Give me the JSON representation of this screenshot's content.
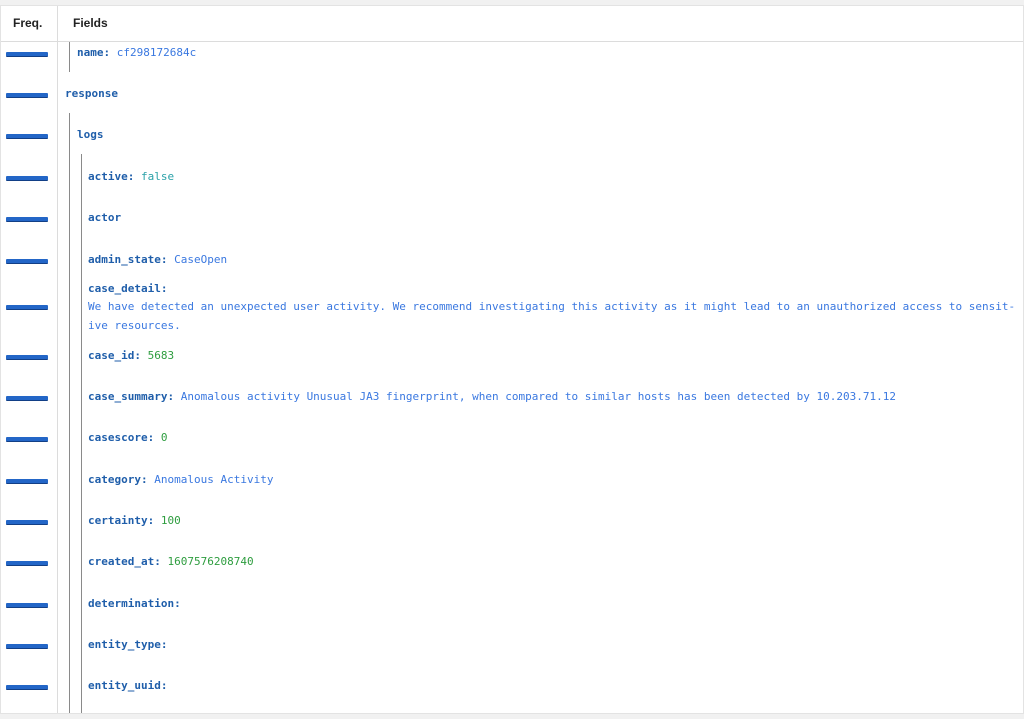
{
  "header": {
    "freq_label": "Freq.",
    "fields_label": "Fields"
  },
  "rows": {
    "name": {
      "key": "name",
      "value": "cf298172684c"
    },
    "response": {
      "key": "response"
    },
    "logs": {
      "key": "logs"
    },
    "active": {
      "key": "active",
      "value": "false"
    },
    "actor": {
      "key": "actor"
    },
    "admin_state": {
      "key": "admin_state",
      "value": "CaseOpen"
    },
    "case_detail": {
      "key": "case_detail",
      "value_line1": "We have detected an unexpected user activity. We recommend investigating this activity as it might lead to an unauthorized access to sensit-",
      "value_line2": "ive resources."
    },
    "case_id": {
      "key": "case_id",
      "value": "5683"
    },
    "case_summary": {
      "key": "case_summary",
      "value": "Anomalous activity Unusual JA3 fingerprint, when compared to similar hosts has been detected by 10.203.71.12"
    },
    "casescore": {
      "key": "casescore",
      "value": "0"
    },
    "category": {
      "key": "category",
      "value": "Anomalous Activity"
    },
    "certainty": {
      "key": "certainty",
      "value": "100"
    },
    "created_at": {
      "key": "created_at",
      "value": "1607576208740"
    },
    "determination": {
      "key": "determination"
    },
    "entity_type": {
      "key": "entity_type"
    },
    "entity_uuid": {
      "key": "entity_uuid"
    }
  },
  "colors": {
    "freq_bar": "#2366c7",
    "key": "#1f5eaa",
    "string_value": "#3a78e0",
    "number_value": "#2e9d3f",
    "boolean_value": "#2aa1a8"
  }
}
